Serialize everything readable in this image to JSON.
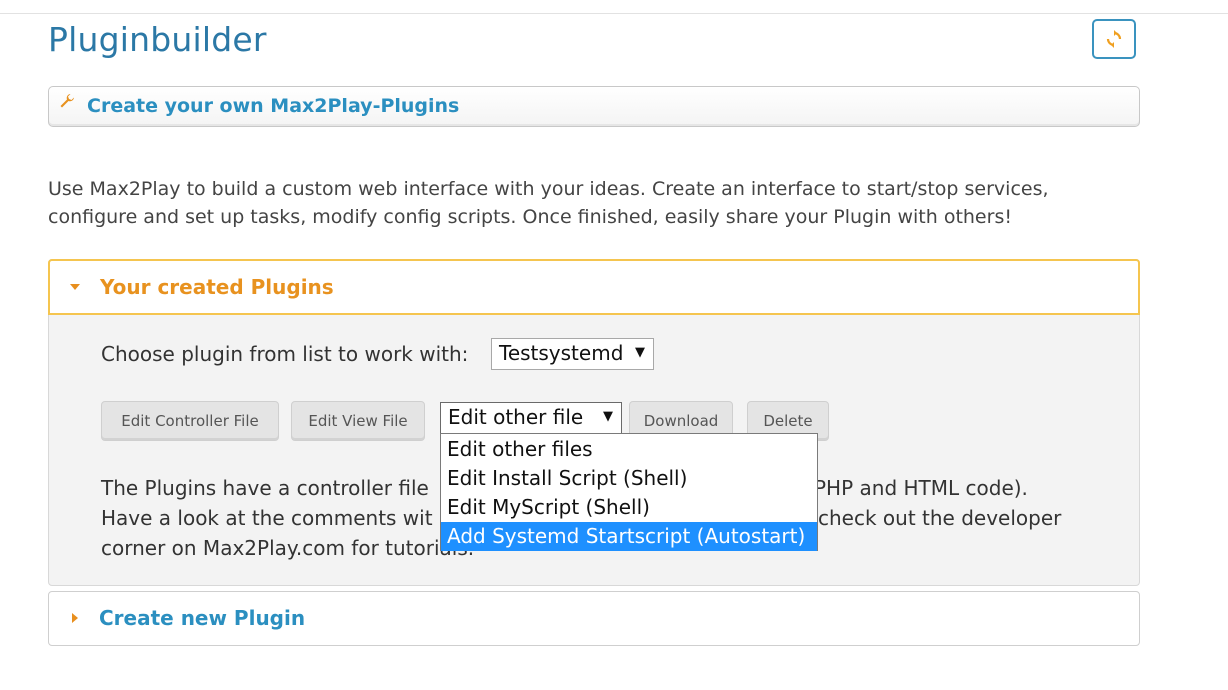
{
  "page": {
    "title": "Pluginbuilder"
  },
  "header_panel": {
    "title": "Create your own Max2Play-Plugins"
  },
  "intro": "Use Max2Play to build a custom web interface with your ideas. Create an interface to start/stop services, configure and set up tasks, modify config scripts. Once finished, easily share your Plugin with others!",
  "created_plugins": {
    "title": "Your created Plugins",
    "choose_label": "Choose plugin from list to work with:",
    "selected_plugin": "Testsystemd",
    "buttons": {
      "edit_controller": "Edit Controller File",
      "edit_view": "Edit View File",
      "download": "Download",
      "delete": "Delete"
    },
    "other_file_select": {
      "value": "Edit other file",
      "options": [
        "Edit other files",
        "Edit Install Script (Shell)",
        "Edit MyScript (Shell)",
        "Add Systemd Startscript (Autostart)"
      ],
      "highlighted": "Add Systemd Startscript (Autostart)"
    },
    "description_lines": [
      "The Plugins have a controller file",
      "PHP and HTML code).",
      "Have a look at the comments wit",
      "check out the developer",
      "corner on Max2Play.com for tutorials."
    ]
  },
  "create_new": {
    "title": "Create new Plugin"
  },
  "icons": {
    "refresh": "refresh-icon",
    "wrench": "wrench-icon",
    "caret_open": "caret-down-icon",
    "caret_closed": "caret-right-icon",
    "select_arrow": "triangle-down-icon"
  },
  "colors": {
    "accent_blue": "#2b8fc0",
    "accent_orange": "#e8921f",
    "highlight": "#1e90ff"
  }
}
